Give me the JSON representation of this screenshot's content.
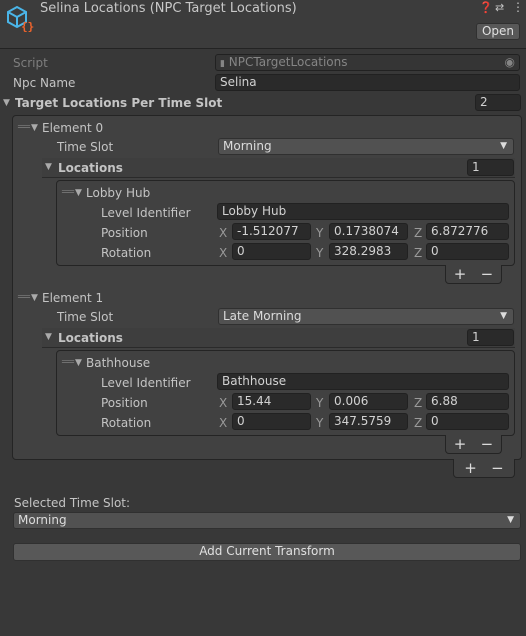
{
  "header": {
    "title": "Selina Locations (NPC Target Locations)",
    "open_label": "Open",
    "icons": [
      "script-cube-icon",
      "help-icon",
      "preset-icon",
      "kebab-menu-icon"
    ]
  },
  "script": {
    "label": "Script",
    "value": "NPCTargetLocations"
  },
  "npc_name": {
    "label": "Npc Name",
    "value": "Selina"
  },
  "target_locations": {
    "label": "Target Locations Per Time Slot",
    "size": "2",
    "elements": [
      {
        "label": "Element 0",
        "time_slot_label": "Time Slot",
        "time_slot": "Morning",
        "locations_label": "Locations",
        "locations_size": "1",
        "location": {
          "name": "Lobby Hub",
          "level_identifier_label": "Level Identifier",
          "level_identifier": "Lobby Hub",
          "position_label": "Position",
          "position": {
            "x": "-1.512077",
            "y": "0.1738074",
            "z": "6.872776"
          },
          "rotation_label": "Rotation",
          "rotation": {
            "x": "0",
            "y": "328.2983",
            "z": "0"
          }
        }
      },
      {
        "label": "Element 1",
        "time_slot_label": "Time Slot",
        "time_slot": "Late Morning",
        "locations_label": "Locations",
        "locations_size": "1",
        "location": {
          "name": "Bathhouse",
          "level_identifier_label": "Level Identifier",
          "level_identifier": "Bathhouse",
          "position_label": "Position",
          "position": {
            "x": "15.44",
            "y": "0.006",
            "z": "6.88"
          },
          "rotation_label": "Rotation",
          "rotation": {
            "x": "0",
            "y": "347.5759",
            "z": "0"
          }
        }
      }
    ]
  },
  "axis": {
    "x": "X",
    "y": "Y",
    "z": "Z"
  },
  "list_buttons": {
    "add": "+",
    "remove": "−"
  },
  "selected_time_slot": {
    "label": "Selected Time Slot:",
    "value": "Morning"
  },
  "add_transform_label": "Add Current Transform"
}
